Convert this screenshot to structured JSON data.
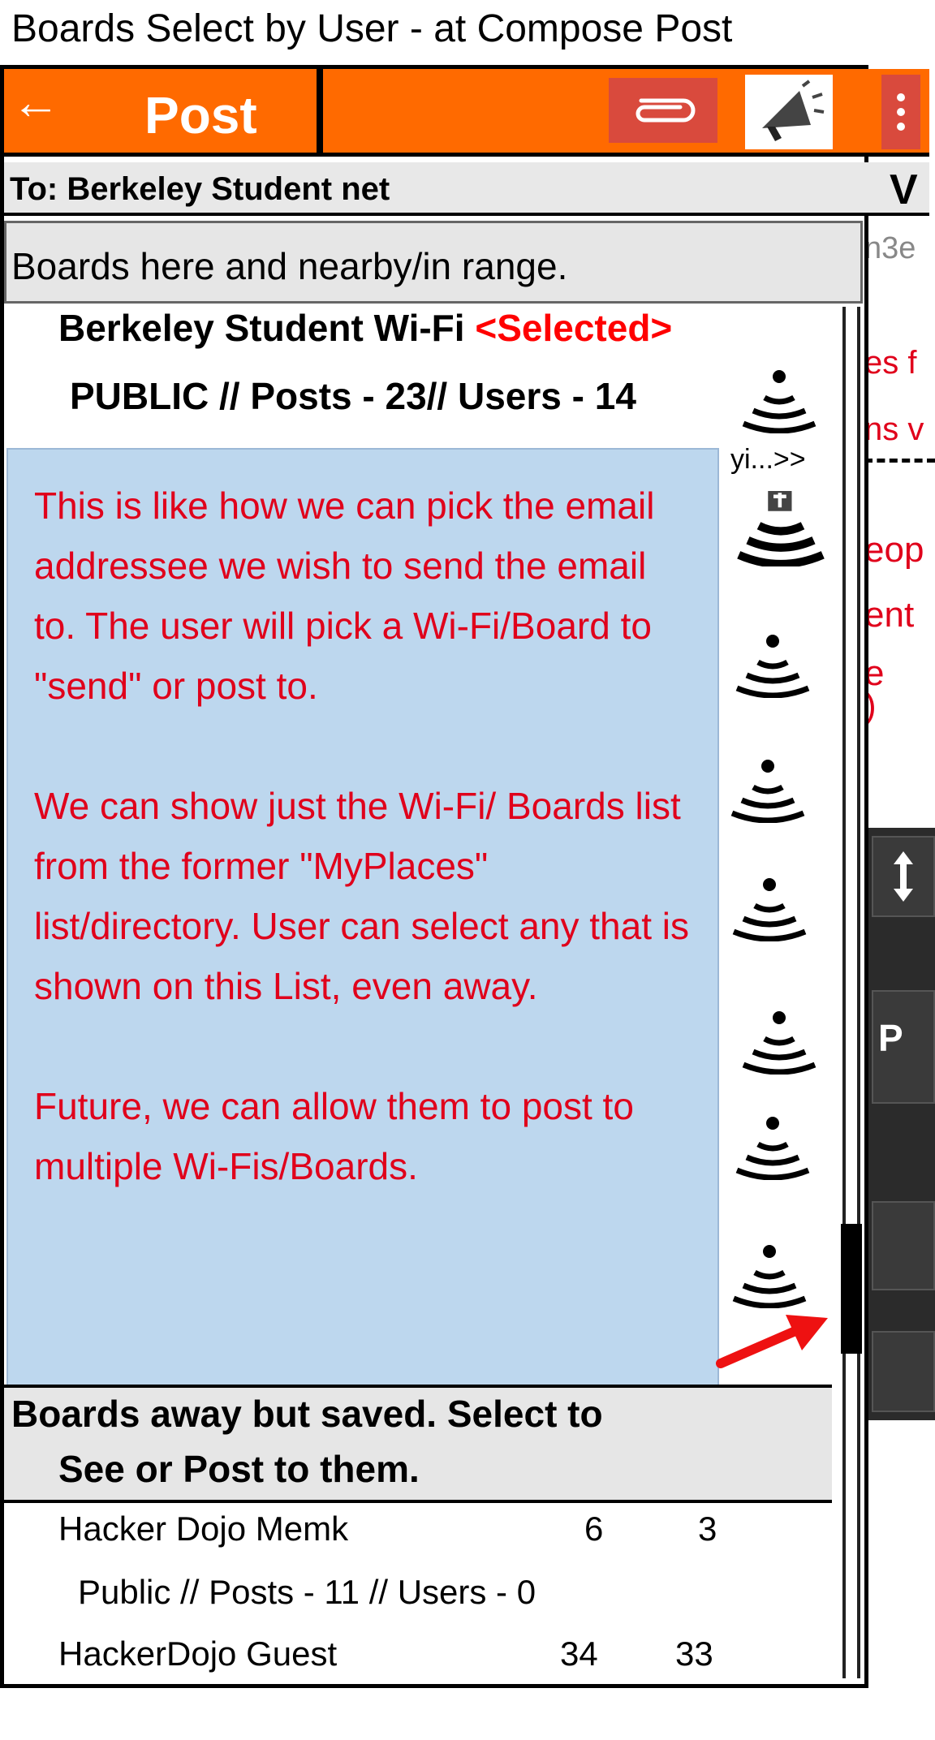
{
  "page": {
    "title": "Boards Select by User - at Compose Post"
  },
  "appbar": {
    "back_icon": "arrow-left-icon",
    "title": "Post",
    "attach_icon": "paperclip-icon",
    "megaphone_icon": "megaphone-icon",
    "more_icon": "more-vertical-icon",
    "color": "#ff6a00"
  },
  "to_bar": {
    "label": "To: Berkeley Student net",
    "chevron": "V"
  },
  "boards_header": {
    "label": "Boards here and nearby/in range."
  },
  "selected_board": {
    "name": "Berkeley Student Wi-Fi",
    "tag": "<Selected>",
    "stats": "PUBLIC // Posts - 23// Users - 14"
  },
  "peek_text": "yi...>>",
  "background_fragments": [
    "n3e",
    "es f",
    "ns v",
    "eop",
    "ent",
    "e",
    ")",
    "P"
  ],
  "callout": {
    "paragraphs": [
      "This is like how we can pick the email addressee we wish to send the email to.  The user will pick a Wi-Fi/Board to \"send\" or post to.",
      "We can show just the Wi-Fi/ Boards list from the former \"MyPlaces\" list/directory. User can select any that is shown on this List, even away.",
      "Future, we can allow them to post to multiple Wi-Fis/Boards."
    ]
  },
  "saved_header": {
    "line1": "Boards away but saved. Select to",
    "line2": "See or Post to them."
  },
  "saved_boards": [
    {
      "name": "Hacker Dojo Memk",
      "a": "6",
      "b": "3"
    },
    {
      "name": "Public  // Posts - 11 // Users - 0",
      "a": "",
      "b": ""
    },
    {
      "name": "HackerDojo Guest",
      "a": "34",
      "b": "33"
    }
  ]
}
